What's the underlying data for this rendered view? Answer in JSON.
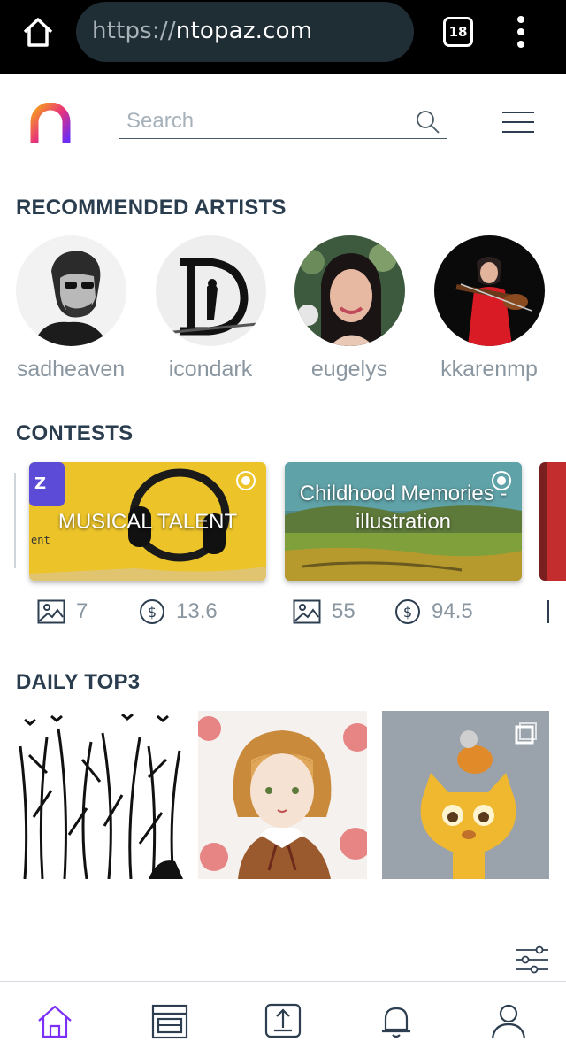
{
  "browser": {
    "url_scheme": "https://",
    "url_host": "ntopaz.com",
    "tab_count": "18"
  },
  "header": {
    "search_placeholder": "Search"
  },
  "sections": {
    "artists_title": "RECOMMENDED ARTISTS",
    "contests_title": "CONTESTS",
    "top3_title": "DAILY TOP3"
  },
  "artists": [
    {
      "name": "sadheaven"
    },
    {
      "name": "icondark"
    },
    {
      "name": "eugelys"
    },
    {
      "name": "kkarenmp"
    }
  ],
  "contests": [
    {
      "title": "MUSICAL TALENT",
      "images": "7",
      "prize": "13.6"
    },
    {
      "title": "Childhood Memories - illustration",
      "images": "55",
      "prize": "94.5"
    }
  ],
  "colors": {
    "accent": "#7b2ff7",
    "logo_gradient_start": "#f7a21b",
    "logo_gradient_end": "#6a2cf5",
    "text_dark": "#2a3d4e",
    "text_muted": "#8a96a0"
  },
  "icons": {
    "nav": [
      "home-icon",
      "feed-icon",
      "upload-icon",
      "bell-icon",
      "profile-icon"
    ]
  }
}
